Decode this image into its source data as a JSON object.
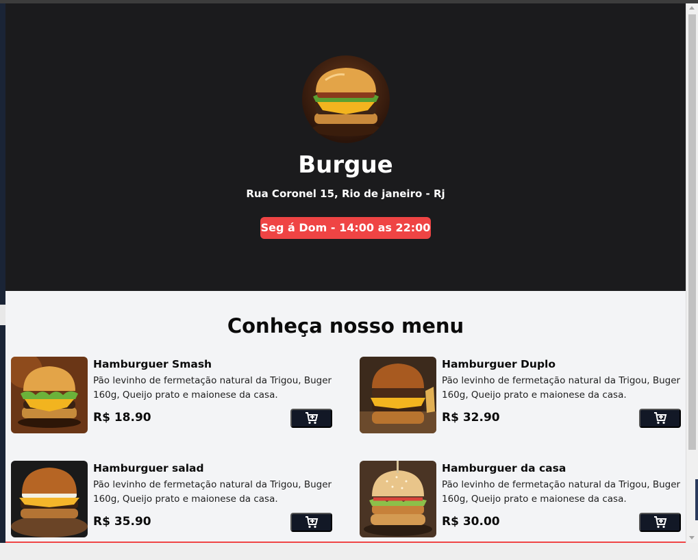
{
  "store": {
    "name": "Burgue",
    "address": "Rua Coronel 15, Rio de janeiro - Rj",
    "hours": "Seg á Dom - 14:00 as 22:00"
  },
  "menu": {
    "title": "Conheça nosso menu",
    "items": [
      {
        "name": "Hamburguer Smash",
        "desc": "Pão levinho de fermetação natural da Trigou, Buger 160g, Queijo prato e maionese da casa.",
        "price": "R$ 18.90"
      },
      {
        "name": "Hamburguer Duplo",
        "desc": "Pão levinho de fermetação natural da Trigou, Buger 160g, Queijo prato e maionese da casa.",
        "price": "R$ 32.90"
      },
      {
        "name": "Hamburguer salad",
        "desc": "Pão levinho de fermetação natural da Trigou, Buger 160g, Queijo prato e maionese da casa.",
        "price": "R$ 35.90"
      },
      {
        "name": "Hamburguer da casa",
        "desc": "Pão levinho de fermetação natural da Trigou, Buger 160g, Queijo prato e maionese da casa.",
        "price": "R$ 30.00"
      }
    ]
  },
  "icons": {
    "cart": "add-to-cart-icon",
    "logo": "burger-logo-image"
  },
  "colors": {
    "hero_bg": "#1b1b1d",
    "accent": "#ef4444",
    "button": "#121826",
    "page_bg": "#f3f4f6"
  }
}
